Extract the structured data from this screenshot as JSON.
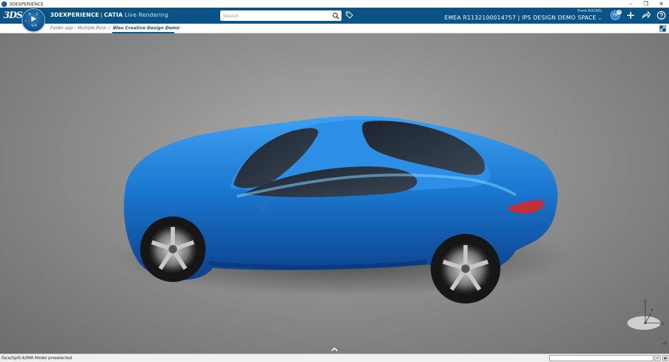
{
  "window": {
    "title": "3DEXPERIENCE",
    "minimize": "–",
    "restore": "❐",
    "close": "✕"
  },
  "topbar": {
    "logo": "3DS",
    "brand_main": "3DEXPERIENCE",
    "brand_app": "CATIA",
    "brand_sub": "Live Rendering",
    "search_placeholder": "Search",
    "user_name": "Frank ROCKEL",
    "space": "EMEA R1132100014757 | IPS DESIGN DEMO SPACE",
    "avatar_initials": "FR",
    "avatar_badge": "4"
  },
  "compass": {
    "version": "V,R"
  },
  "tabs": {
    "crumbs": [
      "Folder app",
      "Multiple Root"
    ],
    "active": "Bleu Creative Design Demo",
    "add": "+"
  },
  "triad": {
    "axis_z": "Z",
    "axis_x": "X",
    "axis_y": "Y"
  },
  "statusbar": {
    "text": "Face/Split.6/IMA Model preselected",
    "cmd_value": ""
  },
  "colors": {
    "topbar": "#0a5386",
    "car_body": "#1b78d0",
    "viewport": "#8f8f8f"
  }
}
